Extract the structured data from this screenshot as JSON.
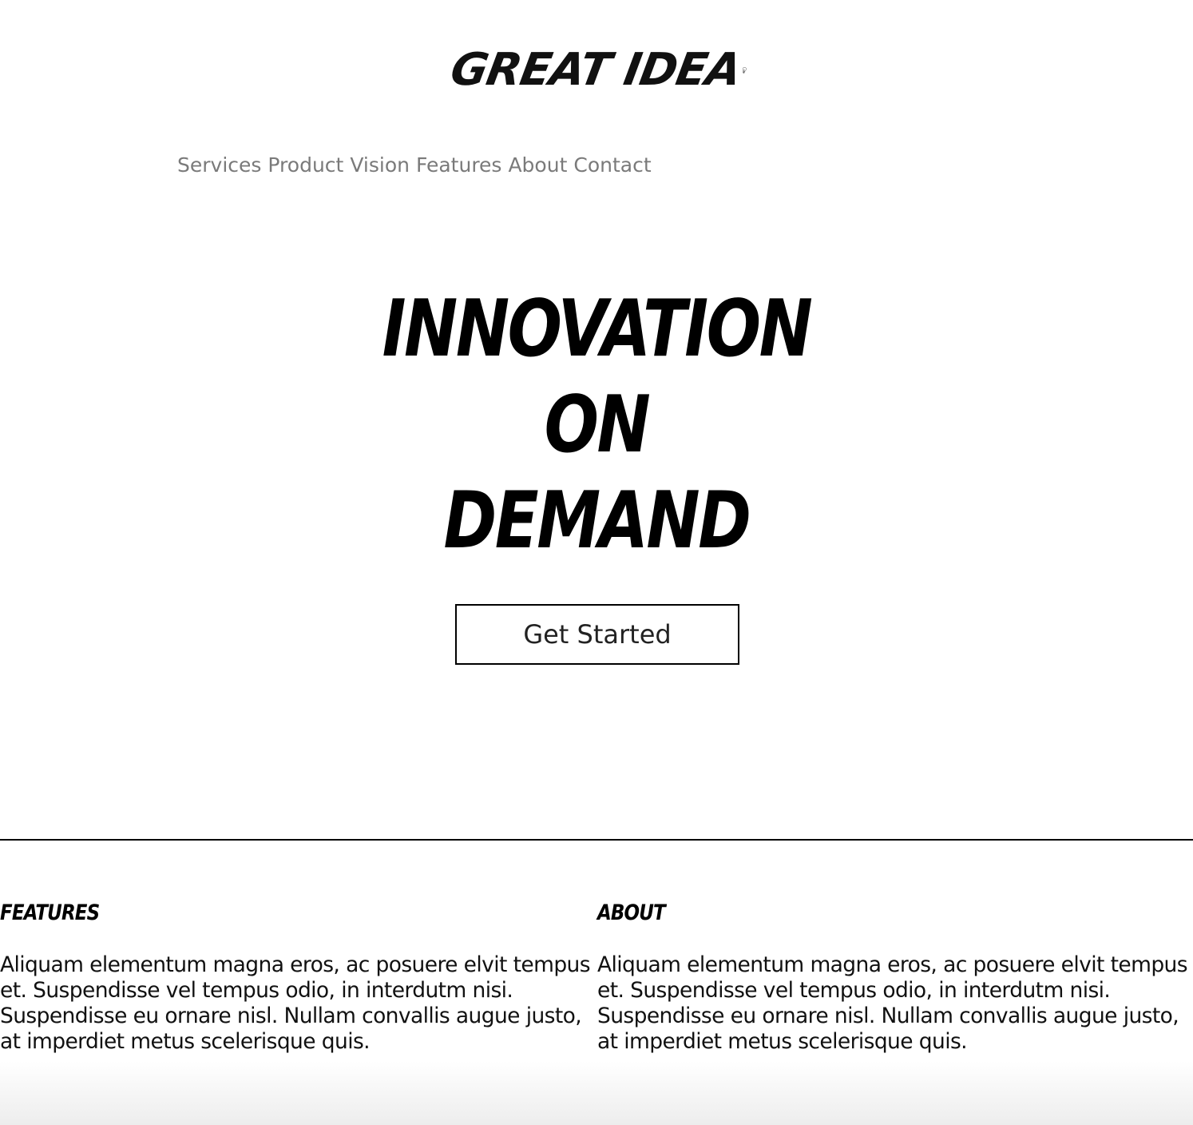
{
  "logo": {
    "text": "GREAT IDEA",
    "icon": "lightbulb-icon"
  },
  "nav": {
    "items": [
      "Services",
      "Product",
      "Vision",
      "Features",
      "About",
      "Contact"
    ]
  },
  "hero": {
    "line1": "INNOVATION",
    "line2": "ON",
    "line3": "DEMAND",
    "cta_label": "Get Started"
  },
  "sections": {
    "features": {
      "title": "FEATURES",
      "body": "Aliquam elementum magna eros, ac posuere elvit tempus et. Suspendisse vel tempus odio, in interdutm nisi. Suspendisse eu ornare nisl. Nullam convallis augue justo, at imperdiet metus scelerisque quis."
    },
    "about": {
      "title": "ABOUT",
      "body": "Aliquam elementum magna eros, ac posuere elvit tempus et. Suspendisse vel tempus odio, in interdutm nisi. Suspendisse eu ornare nisl. Nullam convallis augue justo, at imperdiet metus scelerisque quis."
    }
  },
  "colors": {
    "text": "#111111",
    "nav": "#7a7a7a",
    "background": "#ffffff"
  }
}
